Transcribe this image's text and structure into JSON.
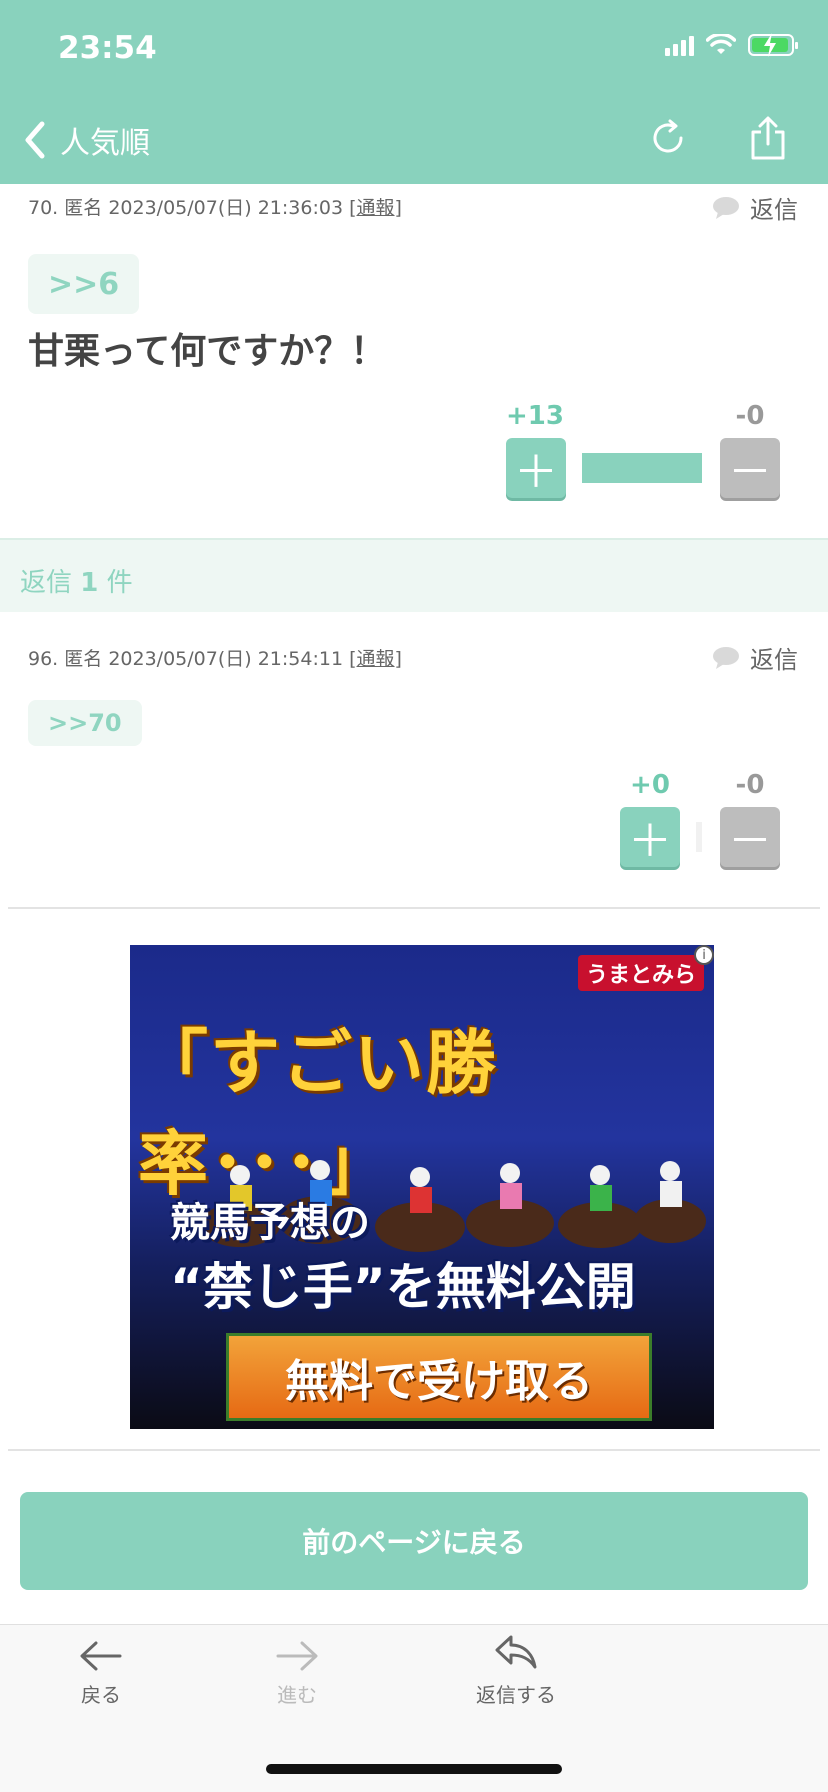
{
  "status_bar": {
    "time": "23:54"
  },
  "nav": {
    "title": "人気順",
    "back_icon": "chevron-left-icon",
    "refresh_icon": "refresh-icon",
    "share_icon": "share-icon"
  },
  "post": {
    "number": "70.",
    "author": "匿名",
    "datetime": "2023/05/07(日) 21:36:03",
    "report_label": "通報",
    "reply_label": "返信",
    "anchor": ">>6",
    "body": "甘栗って何ですか？！",
    "votes": {
      "plus": "+13",
      "minus": "-0",
      "plus_fraction": 1.0
    }
  },
  "replies_header": {
    "prefix": "返信",
    "count": "1",
    "suffix": "件"
  },
  "reply": {
    "number": "96.",
    "author": "匿名",
    "datetime": "2023/05/07(日) 21:54:11",
    "report_label": "通報",
    "reply_label": "返信",
    "anchor": ">>70",
    "votes": {
      "plus": "+0",
      "minus": "-0",
      "plus_fraction": 0.0
    }
  },
  "ad": {
    "logo": "うまとみら",
    "headline": "「すごい勝率･･･」",
    "line1": "競馬予想の",
    "line2": "“禁じ手”を無料公開",
    "cta": "無料で受け取る"
  },
  "back_page_button": "前のページに戻る",
  "toolbar": {
    "back": "戻る",
    "forward": "進む",
    "reply": "返信する"
  },
  "colors": {
    "accent": "#89d2bd",
    "minus": "#bdbdbd"
  }
}
